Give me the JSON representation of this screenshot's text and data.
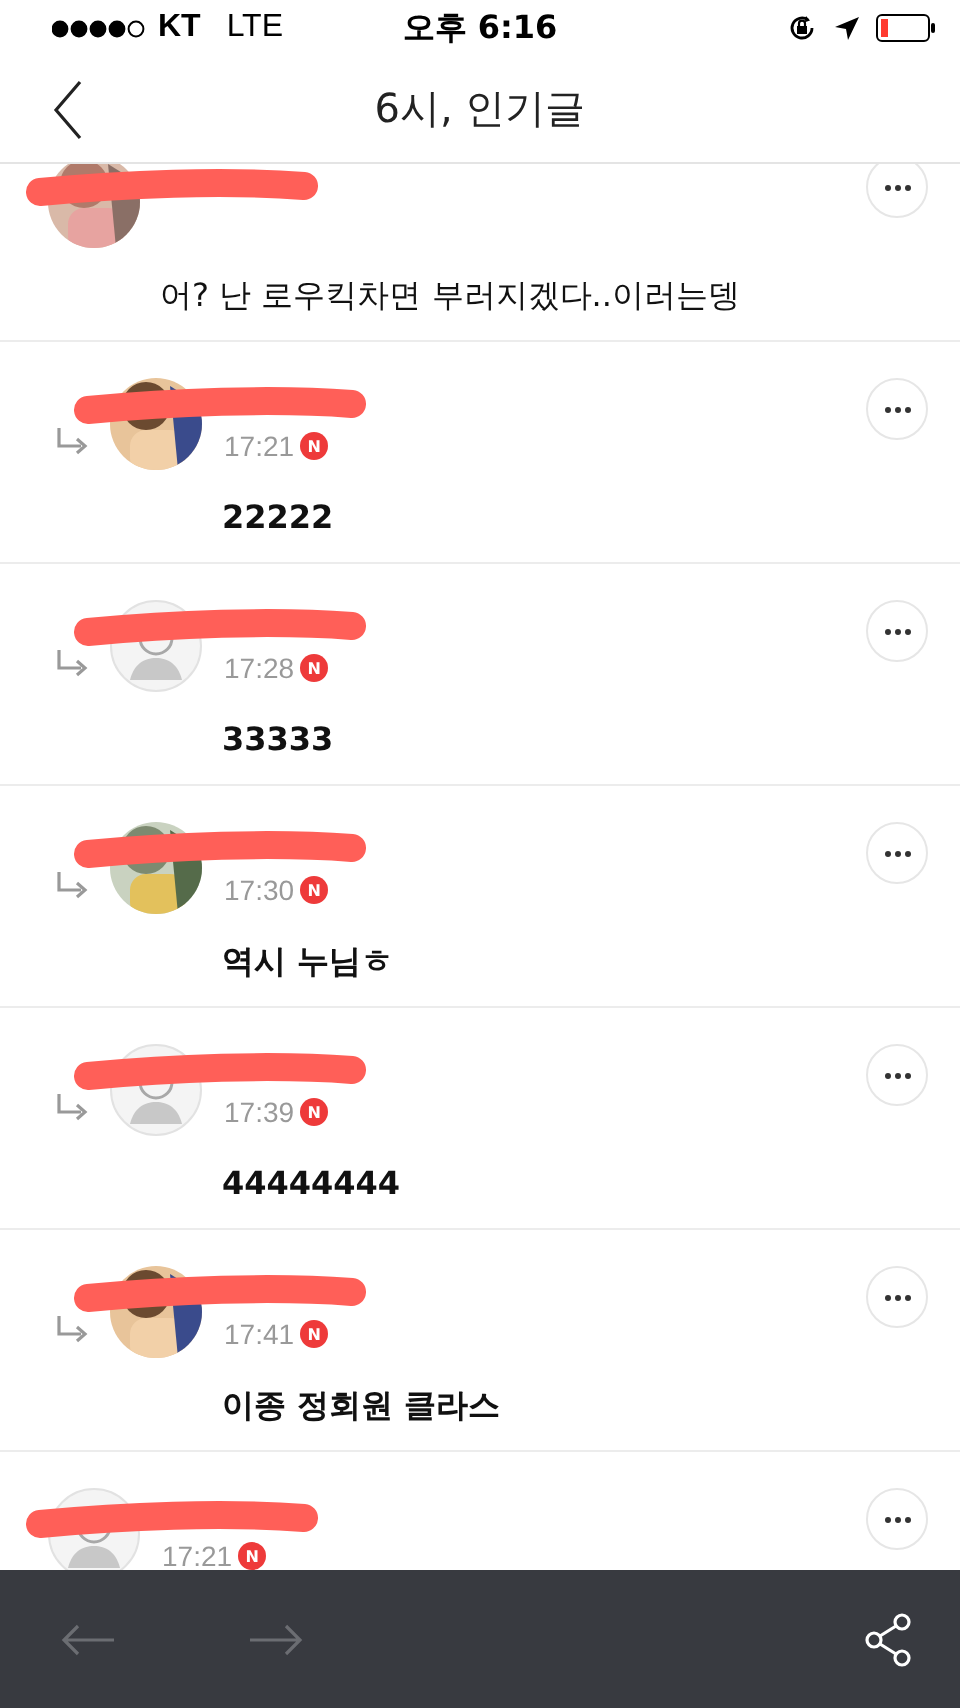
{
  "status_bar": {
    "carrier": "KT",
    "network": "LTE",
    "time": "오후 6:16"
  },
  "nav": {
    "title": "6시, 인기글"
  },
  "comments": [
    {
      "kind": "comment",
      "text": "어? 난 로우킥차면 부러지겠다..이러는뎅"
    },
    {
      "kind": "reply",
      "time": "17:21",
      "badge": "N",
      "text": "22222"
    },
    {
      "kind": "reply",
      "avatar": {
        "kind": "default"
      },
      "time": "17:28",
      "badge": "N",
      "text": "33333"
    },
    {
      "kind": "reply",
      "time": "17:30",
      "badge": "N",
      "text": "역시 누님ㅎ"
    },
    {
      "kind": "reply",
      "avatar": {
        "kind": "default"
      },
      "time": "17:39",
      "badge": "N",
      "text": "44444444"
    },
    {
      "kind": "reply",
      "time": "17:41",
      "badge": "N",
      "text": "이종 정회원 클라스"
    },
    {
      "kind": "comment",
      "avatar": {
        "kind": "default"
      },
      "time": "17:21",
      "badge": "N"
    }
  ]
}
